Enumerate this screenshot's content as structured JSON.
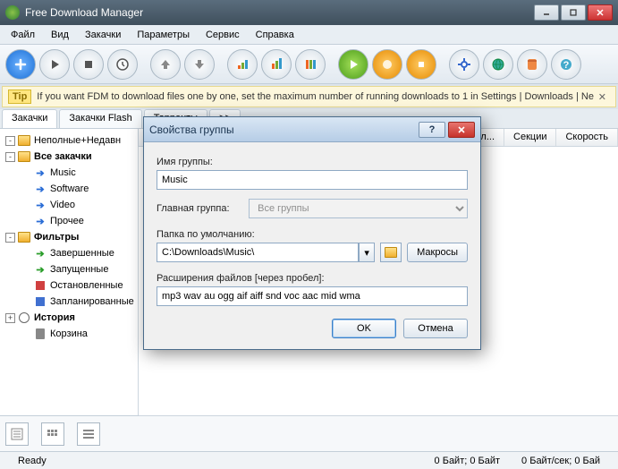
{
  "window": {
    "title": "Free Download Manager"
  },
  "menu": [
    "Файл",
    "Вид",
    "Закачки",
    "Параметры",
    "Сервис",
    "Справка"
  ],
  "tip": {
    "badge": "Tip",
    "text": "If you want FDM to download files one by one, set the maximum number of running downloads to 1 in Settings | Downloads | Ne"
  },
  "tabs": {
    "items": [
      "Закачки",
      "Закачки Flash",
      "Торренты",
      ">>"
    ],
    "activeIndex": 0
  },
  "tree": {
    "items": [
      {
        "indent": 0,
        "toggle": "-",
        "icon": "folder",
        "label": "Неполные+Недавн",
        "bold": false
      },
      {
        "indent": 0,
        "toggle": "-",
        "icon": "folder",
        "label": "Все закачки",
        "bold": true
      },
      {
        "indent": 1,
        "toggle": "",
        "icon": "arrow-blue",
        "label": "Music",
        "bold": false
      },
      {
        "indent": 1,
        "toggle": "",
        "icon": "arrow-blue",
        "label": "Software",
        "bold": false
      },
      {
        "indent": 1,
        "toggle": "",
        "icon": "arrow-blue",
        "label": "Video",
        "bold": false
      },
      {
        "indent": 1,
        "toggle": "",
        "icon": "arrow-blue",
        "label": "Прочее",
        "bold": false
      },
      {
        "indent": 0,
        "toggle": "-",
        "icon": "folder",
        "label": "Фильтры",
        "bold": true
      },
      {
        "indent": 1,
        "toggle": "",
        "icon": "arrow-green",
        "label": "Завершенные",
        "bold": false
      },
      {
        "indent": 1,
        "toggle": "",
        "icon": "arrow-green",
        "label": "Запущенные",
        "bold": false
      },
      {
        "indent": 1,
        "toggle": "",
        "icon": "block-red",
        "label": "Остановленные",
        "bold": false
      },
      {
        "indent": 1,
        "toggle": "",
        "icon": "block-blue",
        "label": "Запланированные",
        "bold": false
      },
      {
        "indent": 0,
        "toggle": "+",
        "icon": "clock",
        "label": "История",
        "bold": true
      },
      {
        "indent": 1,
        "toggle": "",
        "icon": "trash",
        "label": "Корзина",
        "bold": false
      }
    ]
  },
  "columns": [
    "л...",
    "Секции",
    "Скорость"
  ],
  "status": {
    "left": "Ready",
    "mid": "0 Байт; 0 Байт",
    "right": "0 Байт/сек; 0 Бай"
  },
  "dialog": {
    "title": "Свойства группы",
    "labels": {
      "name": "Имя группы:",
      "parent": "Главная группа:",
      "folder": "Папка по умолчанию:",
      "ext": "Расширения файлов [через пробел]:"
    },
    "values": {
      "name": "Music",
      "parent": "Все группы",
      "folder": "C:\\Downloads\\Music\\",
      "ext": "mp3 wav au ogg aif aiff snd voc aac mid wma"
    },
    "buttons": {
      "macros": "Макросы",
      "ok": "OK",
      "cancel": "Отмена"
    }
  }
}
